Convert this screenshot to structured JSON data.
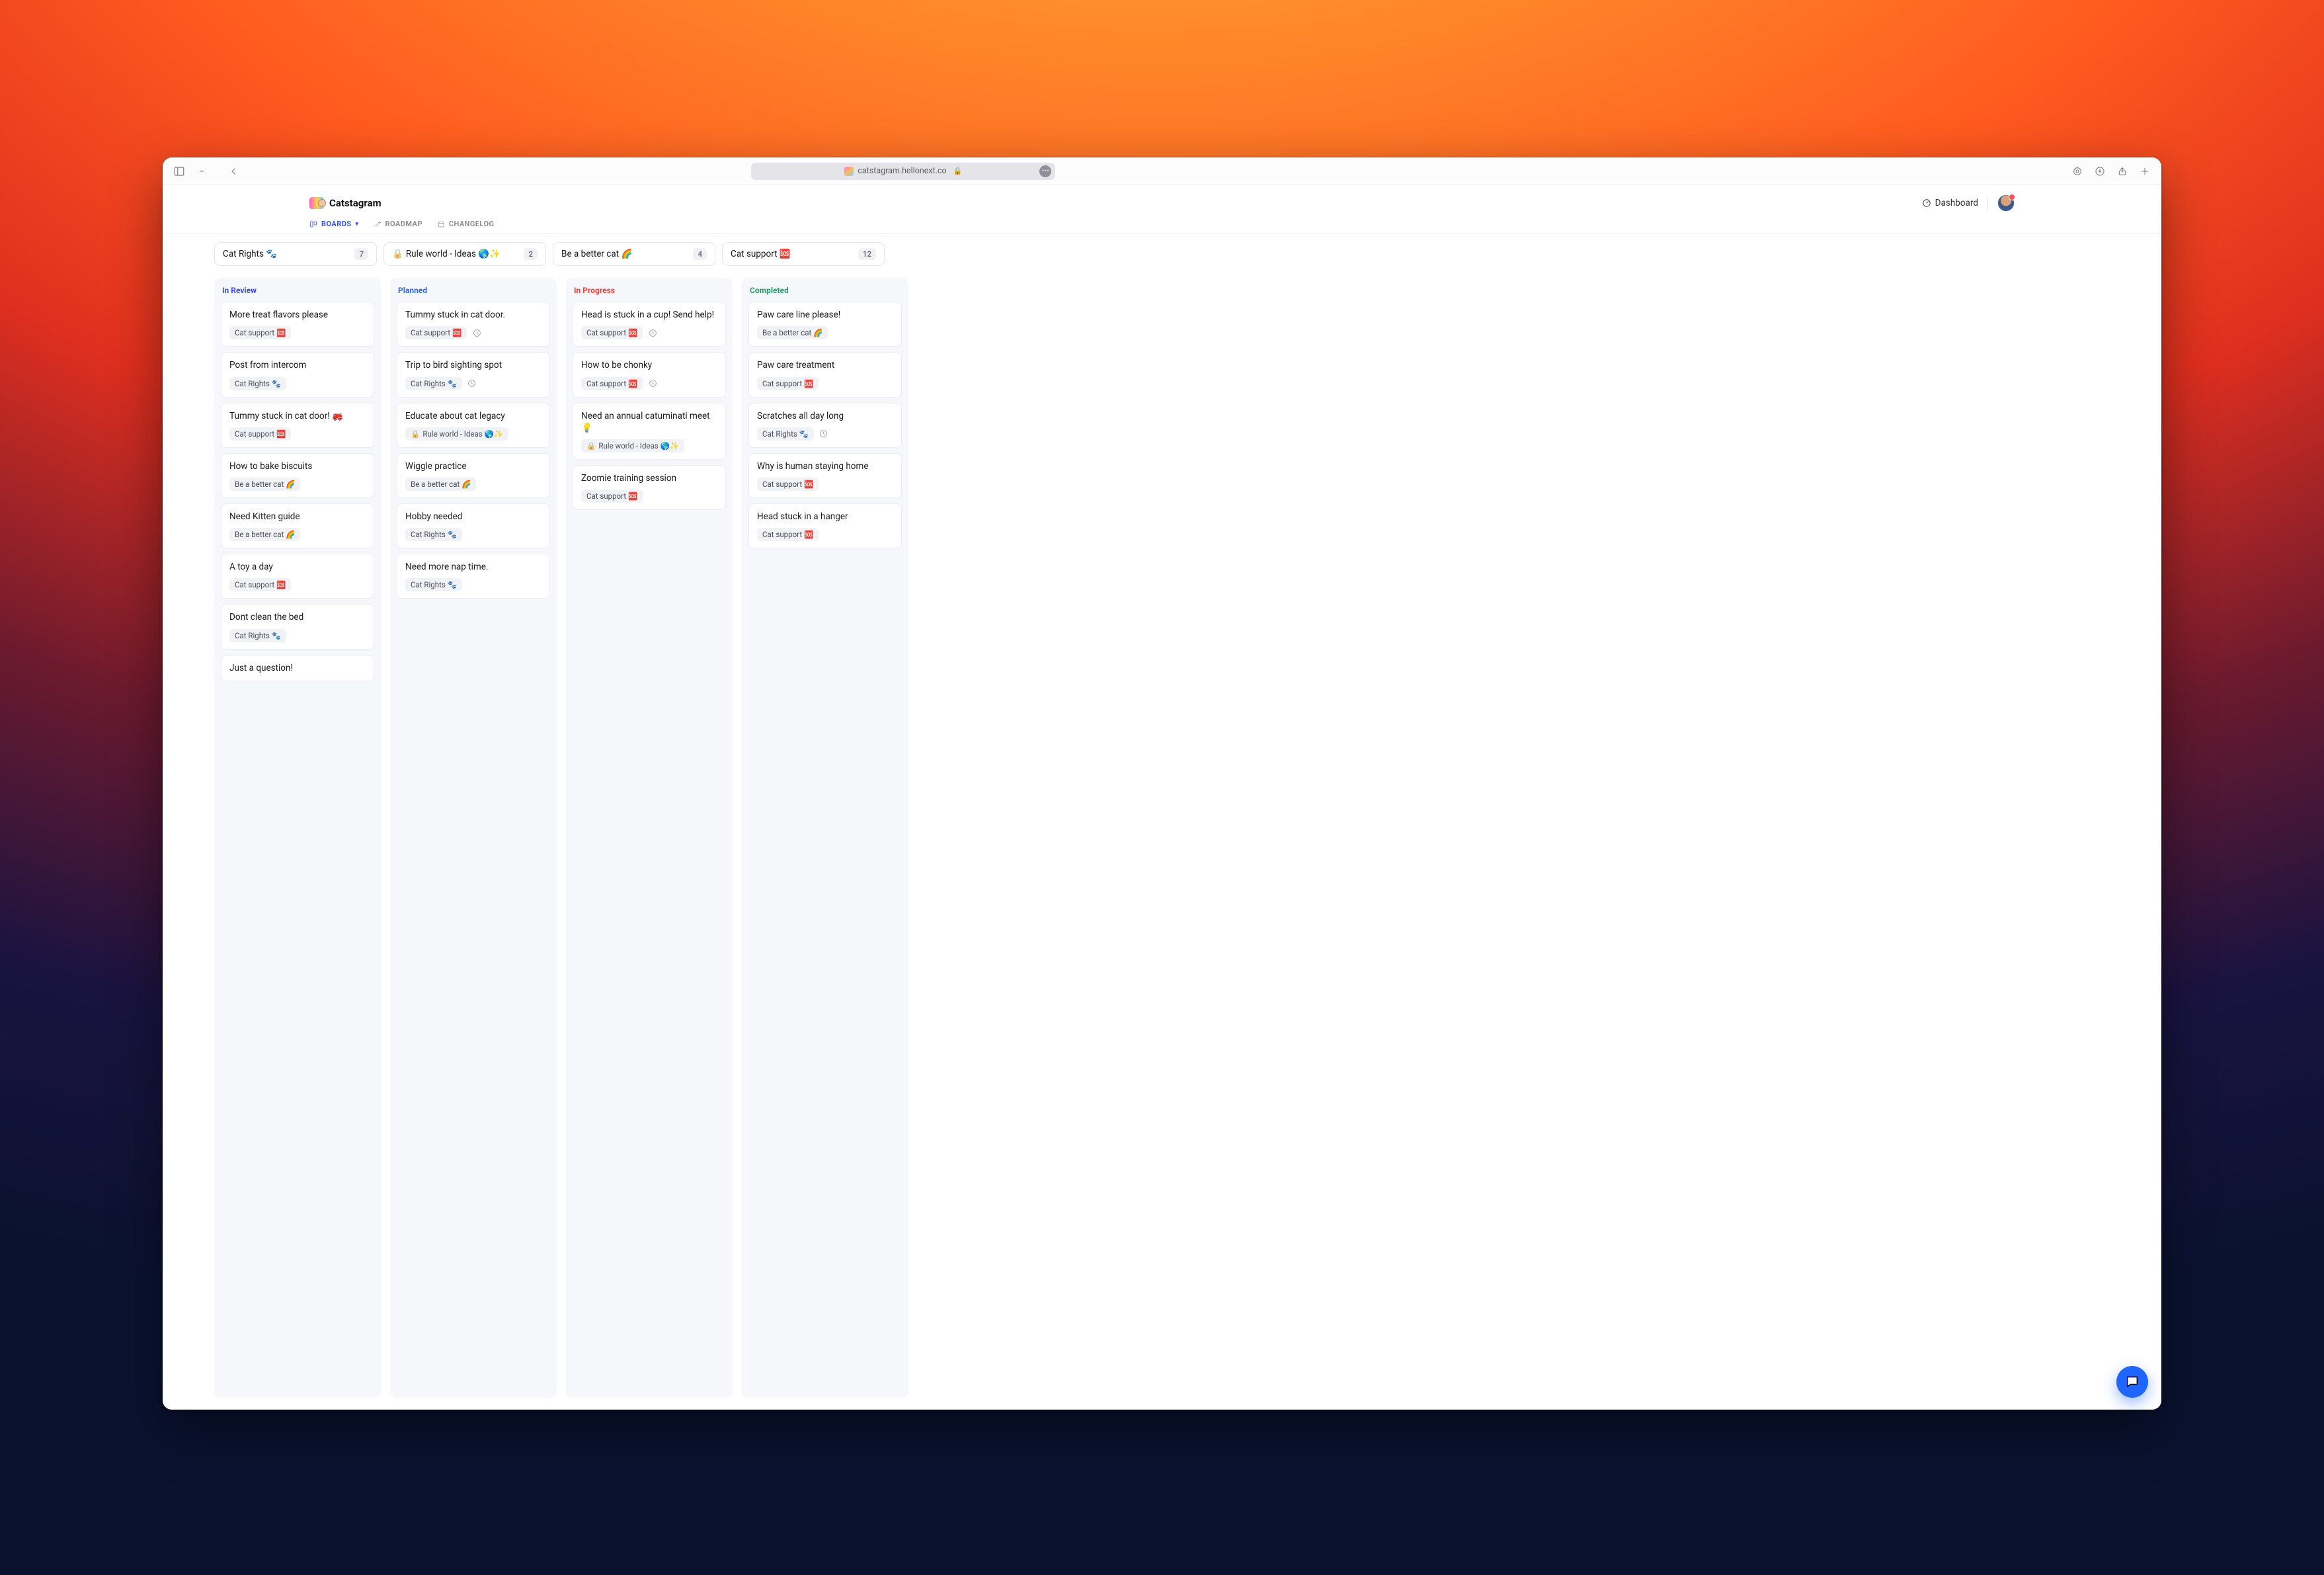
{
  "browser": {
    "url_display": "catstagram.hellonext.co"
  },
  "app": {
    "name": "Catstagram",
    "dashboard_label": "Dashboard",
    "tabs": {
      "boards": "BOARDS",
      "roadmap": "ROADMAP",
      "changelog": "CHANGELOG"
    }
  },
  "filters": [
    {
      "label": "Cat Rights 🐾",
      "count": "7",
      "locked": false
    },
    {
      "label": "Rule world - Ideas 🌎✨",
      "count": "2",
      "locked": true
    },
    {
      "label": "Be a better cat 🌈",
      "count": "4",
      "locked": false
    },
    {
      "label": "Cat support 🆘",
      "count": "12",
      "locked": false
    }
  ],
  "columns": [
    {
      "key": "review",
      "title": "In Review",
      "title_class": "review",
      "cards": [
        {
          "title": "More treat flavors please",
          "tags": [
            {
              "label": "Cat support 🆘"
            }
          ]
        },
        {
          "title": "Post from intercom",
          "tags": [
            {
              "label": "Cat Rights 🐾"
            }
          ]
        },
        {
          "title": "Tummy stuck in cat door! 🚒",
          "tags": [
            {
              "label": "Cat support 🆘"
            }
          ]
        },
        {
          "title": "How to bake biscuits",
          "tags": [
            {
              "label": "Be a better cat 🌈"
            }
          ]
        },
        {
          "title": "Need Kitten guide",
          "tags": [
            {
              "label": "Be a better cat 🌈"
            }
          ]
        },
        {
          "title": "A toy a day",
          "tags": [
            {
              "label": "Cat support 🆘"
            }
          ]
        },
        {
          "title": "Dont clean the bed",
          "tags": [
            {
              "label": "Cat Rights 🐾"
            }
          ]
        },
        {
          "title": "Just a question!",
          "tags": []
        }
      ]
    },
    {
      "key": "planned",
      "title": "Planned",
      "title_class": "planned",
      "cards": [
        {
          "title": "Tummy stuck in cat door.",
          "tags": [
            {
              "label": "Cat support 🆘"
            }
          ],
          "has_clock": true
        },
        {
          "title": "Trip to bird sighting spot",
          "tags": [
            {
              "label": "Cat Rights 🐾"
            }
          ],
          "has_clock": true
        },
        {
          "title": "Educate about cat legacy",
          "tags": [
            {
              "label": "Rule world - Ideas 🌎✨",
              "locked": true
            }
          ]
        },
        {
          "title": "Wiggle practice",
          "tags": [
            {
              "label": "Be a better cat 🌈"
            }
          ]
        },
        {
          "title": "Hobby needed",
          "tags": [
            {
              "label": "Cat Rights 🐾"
            }
          ]
        },
        {
          "title": "Need more nap time.",
          "tags": [
            {
              "label": "Cat Rights 🐾"
            }
          ]
        }
      ]
    },
    {
      "key": "progress",
      "title": "In Progress",
      "title_class": "progress",
      "cards": [
        {
          "title": "Head is stuck in a cup! Send help!",
          "tags": [
            {
              "label": "Cat support 🆘"
            }
          ],
          "has_clock": true
        },
        {
          "title": "How to be chonky",
          "tags": [
            {
              "label": "Cat support 🆘"
            }
          ],
          "has_clock": true
        },
        {
          "title": "Need an annual catuminati meet 💡",
          "tags": [
            {
              "label": "Rule world - Ideas 🌎✨",
              "locked": true
            }
          ]
        },
        {
          "title": "Zoomie training session",
          "tags": [
            {
              "label": "Cat support 🆘"
            }
          ]
        }
      ]
    },
    {
      "key": "completed",
      "title": "Completed",
      "title_class": "completed",
      "cards": [
        {
          "title": "Paw care line please!",
          "tags": [
            {
              "label": "Be a better cat 🌈"
            }
          ]
        },
        {
          "title": "Paw care treatment",
          "tags": [
            {
              "label": "Cat support 🆘"
            }
          ]
        },
        {
          "title": "Scratches all day long",
          "tags": [
            {
              "label": "Cat Rights 🐾"
            }
          ],
          "has_clock": true
        },
        {
          "title": "Why is human staying home",
          "tags": [
            {
              "label": "Cat support 🆘"
            }
          ]
        },
        {
          "title": "Head stuck in a hanger",
          "tags": [
            {
              "label": "Cat support 🆘"
            }
          ]
        }
      ]
    }
  ]
}
